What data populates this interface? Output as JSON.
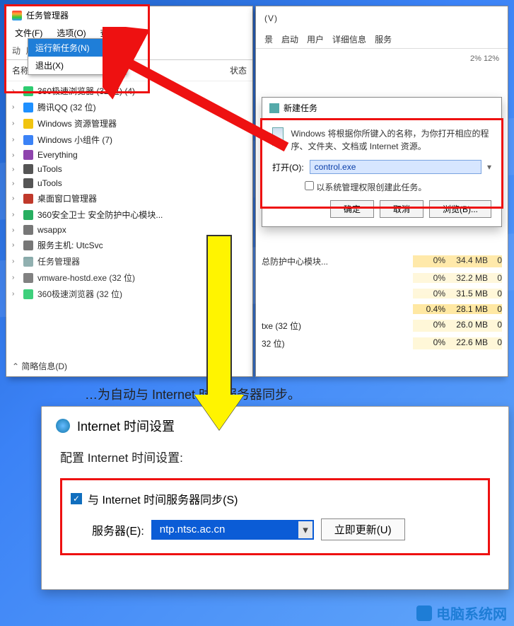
{
  "taskmgr": {
    "title": "任务管理器",
    "menus": {
      "file": "文件(F)",
      "options": "选项(O)",
      "view": "查看(V)"
    },
    "file_dropdown": {
      "run_new": "运行新任务(N)",
      "exit": "退出(X)"
    },
    "fake_tabs": "动  用户  详细信息  服务",
    "cols": {
      "name": "名称",
      "status": "状态"
    },
    "processes": [
      {
        "icon": "#2ecc71",
        "label": "360极速浏览器 (32 位) (4)"
      },
      {
        "icon": "#1e90ff",
        "label": "腾讯QQ (32 位)"
      },
      {
        "icon": "#f1c40f",
        "label": "Windows 资源管理器"
      },
      {
        "icon": "#3b82f6",
        "label": "Windows 小组件 (7)"
      },
      {
        "icon": "#8e44ad",
        "label": "Everything"
      },
      {
        "icon": "#555",
        "label": "uTools"
      },
      {
        "icon": "#555",
        "label": "uTools"
      },
      {
        "icon": "#c0392b",
        "label": "桌面窗口管理器"
      },
      {
        "icon": "#27ae60",
        "label": "360安全卫士 安全防护中心模块..."
      },
      {
        "icon": "#777",
        "label": "wsappx"
      },
      {
        "icon": "#777",
        "label": "服务主机: UtcSvc"
      },
      {
        "icon": "#8aa",
        "label": "任务管理器"
      },
      {
        "icon": "#777",
        "label": "vmware-hostd.exe (32 位)"
      },
      {
        "icon": "#2ecc71",
        "label": "360极速浏览器 (32 位)"
      }
    ],
    "footer": "简略信息(D)"
  },
  "rightpane": {
    "top_menu_trail": "(V)",
    "tabs": [
      "景",
      "启动",
      "用户",
      "详细信息",
      "服务"
    ],
    "summary": "2%     12%",
    "newtask": {
      "title": "新建任务",
      "desc": "Windows 将根据你所键入的名称，为你打开相应的程序、文件夹、文档或 Internet 资源。",
      "open_label": "打开(O):",
      "open_value": "control.exe",
      "admin_label": "以系统管理权限创建此任务。",
      "btn_ok": "确定",
      "btn_cancel": "取消",
      "btn_browse": "浏览(B)..."
    },
    "rows": [
      {
        "name": "总防护中心模块...",
        "cpu": "0%",
        "mem": "34.4 MB",
        "z": "0",
        "hi": true
      },
      {
        "name": "",
        "cpu": "0%",
        "mem": "32.2 MB",
        "z": "0"
      },
      {
        "name": "",
        "cpu": "0%",
        "mem": "31.5 MB",
        "z": "0"
      },
      {
        "name": "",
        "cpu": "0.4%",
        "mem": "28.1 MB",
        "z": "0",
        "hi": true
      },
      {
        "name": "txe (32 位)",
        "cpu": "0%",
        "mem": "26.0 MB",
        "z": "0"
      },
      {
        "name": "32 位)",
        "cpu": "0%",
        "mem": "22.6 MB",
        "z": "0"
      }
    ]
  },
  "hint_row": "…为自动与 Internet 时间服务器同步。",
  "time_dialog": {
    "title": "Internet 时间设置",
    "subtitle": "配置 Internet 时间设置:",
    "sync_label": "与 Internet 时间服务器同步(S)",
    "server_label": "服务器(E):",
    "server_value": "ntp.ntsc.ac.cn",
    "update_btn": "立即更新(U)"
  },
  "watermark": "电脑系统网"
}
